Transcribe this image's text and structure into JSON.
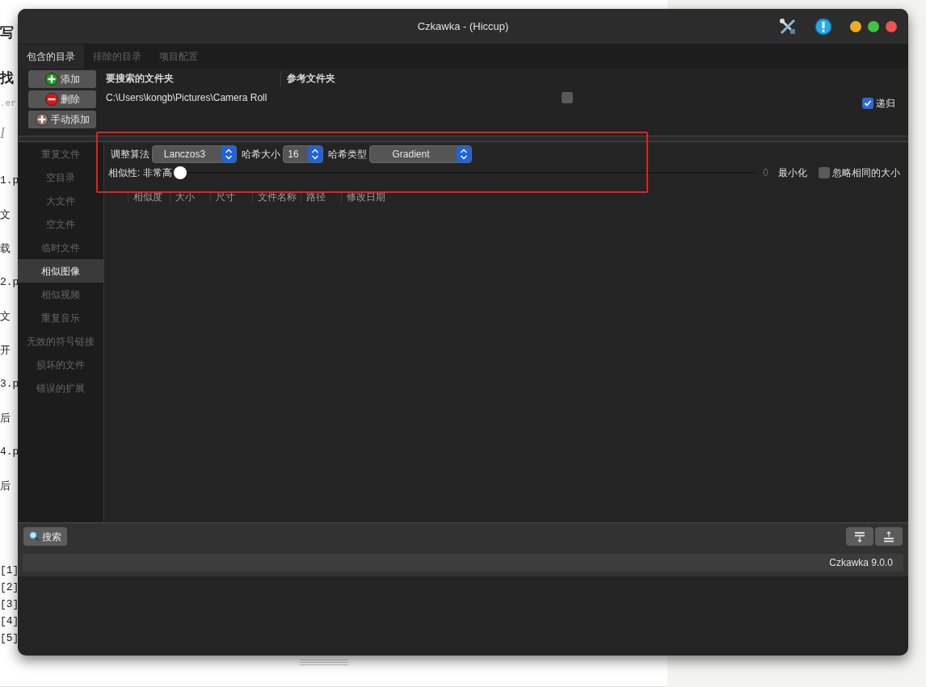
{
  "background_page": {
    "fragments": [
      {
        "text": "写",
        "kind": "heading"
      },
      {
        "text": "找",
        "kind": "heading"
      },
      {
        "text": ".er",
        "kind": "faint"
      },
      {
        "text": "I",
        "kind": "italic"
      },
      {
        "text": "1.p",
        "kind": "mono"
      },
      {
        "text": "文",
        "kind": "text"
      },
      {
        "text": "载",
        "kind": "text"
      },
      {
        "text": "2.p",
        "kind": "mono"
      },
      {
        "text": "文",
        "kind": "text"
      },
      {
        "text": "开",
        "kind": "text"
      },
      {
        "text": "3.p",
        "kind": "mono"
      },
      {
        "text": "后",
        "kind": "text"
      },
      {
        "text": "4.p",
        "kind": "mono"
      },
      {
        "text": "后",
        "kind": "text"
      },
      {
        "text": "[1]",
        "kind": "mono"
      },
      {
        "text": "[2]",
        "kind": "mono"
      },
      {
        "text": "[3]",
        "kind": "mono"
      },
      {
        "text": "[4]",
        "kind": "mono"
      },
      {
        "text": "[5]",
        "kind": "mono"
      }
    ]
  },
  "window": {
    "title": "Czkawka - (Hiccup)"
  },
  "tabs": [
    {
      "label": "包含的目录",
      "selected": true
    },
    {
      "label": "排除的目录",
      "selected": false
    },
    {
      "label": "项目配置",
      "selected": false
    }
  ],
  "directory_buttons": [
    {
      "label": "添加",
      "kind": "add"
    },
    {
      "label": "删除",
      "kind": "remove"
    },
    {
      "label": "手动添加",
      "kind": "manual"
    }
  ],
  "directories": {
    "columns": [
      "要搜索的文件夹",
      "参考文件夹"
    ],
    "rows": [
      {
        "path": "C:\\Users\\kongb\\Pictures\\Camera Roll",
        "reference": false
      }
    ]
  },
  "recursive": {
    "label": "递归",
    "checked": true
  },
  "sidebar": {
    "items": [
      {
        "label": "重复文件",
        "selected": false
      },
      {
        "label": "空目录",
        "selected": false
      },
      {
        "label": "大文件",
        "selected": false
      },
      {
        "label": "空文件",
        "selected": false
      },
      {
        "label": "临时文件",
        "selected": false
      },
      {
        "label": "相似图像",
        "selected": true
      },
      {
        "label": "相似视频",
        "selected": false
      },
      {
        "label": "重复音乐",
        "selected": false
      },
      {
        "label": "无效的符号链接",
        "selected": false
      },
      {
        "label": "损坏的文件",
        "selected": false
      },
      {
        "label": "错误的扩展",
        "selected": false
      }
    ]
  },
  "settings": {
    "selects": [
      {
        "label": "调整算法",
        "value": "Lanczos3"
      },
      {
        "label": "哈希大小",
        "value": "16"
      },
      {
        "label": "哈希类型",
        "value": "Gradient"
      }
    ],
    "similarity": {
      "label": "相似性: 非常高",
      "level": 0,
      "reading": "0",
      "end_label": "最小化"
    },
    "ignore_same_size": {
      "label": "忽略相同的大小",
      "checked": false
    }
  },
  "results": {
    "columns": [
      "相似度",
      "大小",
      "尺寸",
      "文件名称",
      "路径",
      "修改日期"
    ]
  },
  "search_button": "搜索",
  "status_bar": "Czkawka 9.0.0"
}
